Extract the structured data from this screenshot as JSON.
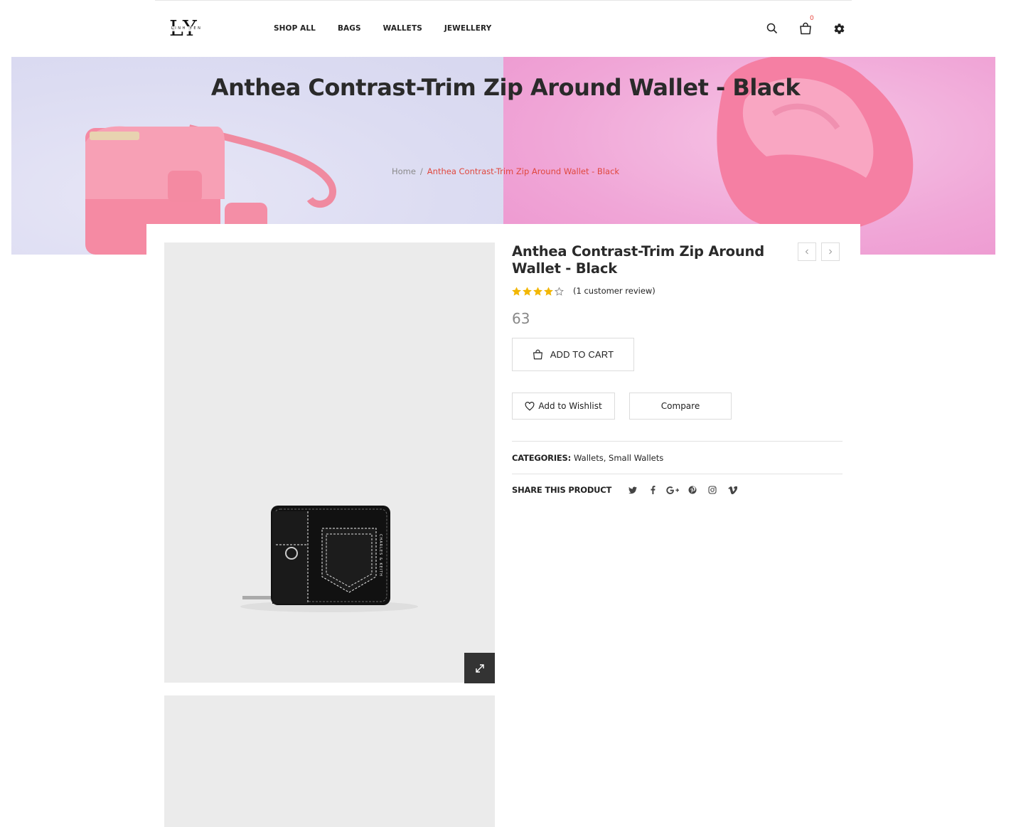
{
  "header": {
    "logo": {
      "mark": "LY",
      "subtext": "LINH YEN"
    },
    "nav": [
      "SHOP ALL",
      "BAGS",
      "WALLETS",
      "JEWELLERY"
    ],
    "icons": [
      "search-icon",
      "cart-icon",
      "gear-icon"
    ],
    "cart_count": "0"
  },
  "hero": {
    "title": "Anthea Contrast-Trim Zip Around Wallet - Black",
    "breadcrumb": {
      "home": "Home",
      "separator": "/",
      "current": "Anthea Contrast-Trim Zip Around Wallet - Black"
    }
  },
  "product": {
    "title": "Anthea Contrast-Trim Zip Around Wallet - Black",
    "rating": 4,
    "rating_max": 5,
    "review_text": "(1 customer review)",
    "price": "63",
    "add_to_cart": "ADD TO CART",
    "wishlist": "Add to Wishlist",
    "compare": "Compare",
    "categories_label": "CATEGORIES:",
    "categories": [
      "Wallets",
      "Small Wallets"
    ],
    "share_label": "SHARE THIS PRODUCT",
    "share_icons": [
      "twitter-icon",
      "facebook-icon",
      "google-plus-icon",
      "pinterest-icon",
      "instagram-icon",
      "vimeo-icon"
    ],
    "image_brand_text": "CHARLES & KEITH"
  },
  "colors": {
    "accent": "#e0483e",
    "star": "#f2b705",
    "hero_left": "#dcdcf2",
    "hero_right": "#f0a6d7",
    "image_bg": "#ebebeb"
  }
}
